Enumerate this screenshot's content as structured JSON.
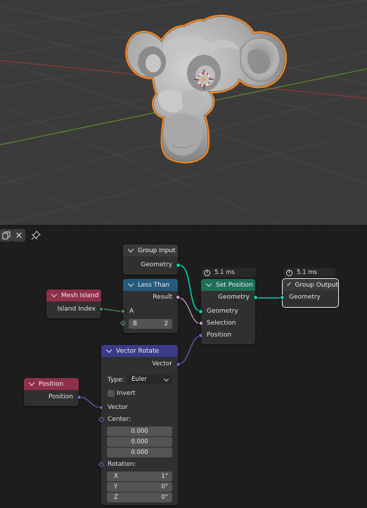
{
  "toolbar": {
    "icons": [
      "copy-icon",
      "close-icon",
      "pin-icon"
    ],
    "close_glyph": "×"
  },
  "nodes": {
    "group_input": {
      "title": "Group Input",
      "outputs": [
        "Geometry"
      ]
    },
    "mesh_island": {
      "title": "Mesh Island",
      "outputs": [
        "Island Index"
      ],
      "color": "#8f2f48"
    },
    "less_than": {
      "title": "Less Than",
      "outputs": [
        "Result"
      ],
      "inputs": [
        "A"
      ],
      "b_label": "B",
      "b_value": "2",
      "color": "#245a7c"
    },
    "set_position": {
      "title": "Set Position",
      "timing": "5.1 ms",
      "outputs": [
        "Geometry"
      ],
      "inputs": [
        "Geometry",
        "Selection",
        "Position"
      ],
      "color": "#1f6e5a"
    },
    "group_output": {
      "title": "Group Output",
      "timing": "5.1 ms",
      "inputs": [
        "Geometry"
      ]
    },
    "position": {
      "title": "Position",
      "outputs": [
        "Position"
      ],
      "color": "#8f2f48"
    },
    "vector_rotate": {
      "title": "Vector Rotate",
      "color": "#3b3b8a",
      "output": "Vector",
      "type_label": "Type:",
      "type_value": "Euler",
      "invert_label": "Invert",
      "vector_label": "Vector",
      "center_label": "Center:",
      "center_values": [
        "0.000",
        "0.000",
        "0.000"
      ],
      "rotation_label": "Rotation:",
      "rotation_axes": [
        {
          "axis": "X",
          "value": "1°"
        },
        {
          "axis": "Y",
          "value": "0°"
        },
        {
          "axis": "Z",
          "value": "0°"
        }
      ]
    }
  },
  "colors": {
    "geometry_socket": "#00d6a3",
    "vector_socket": "#6363c7",
    "selection_outline": "#ff8a1c"
  }
}
